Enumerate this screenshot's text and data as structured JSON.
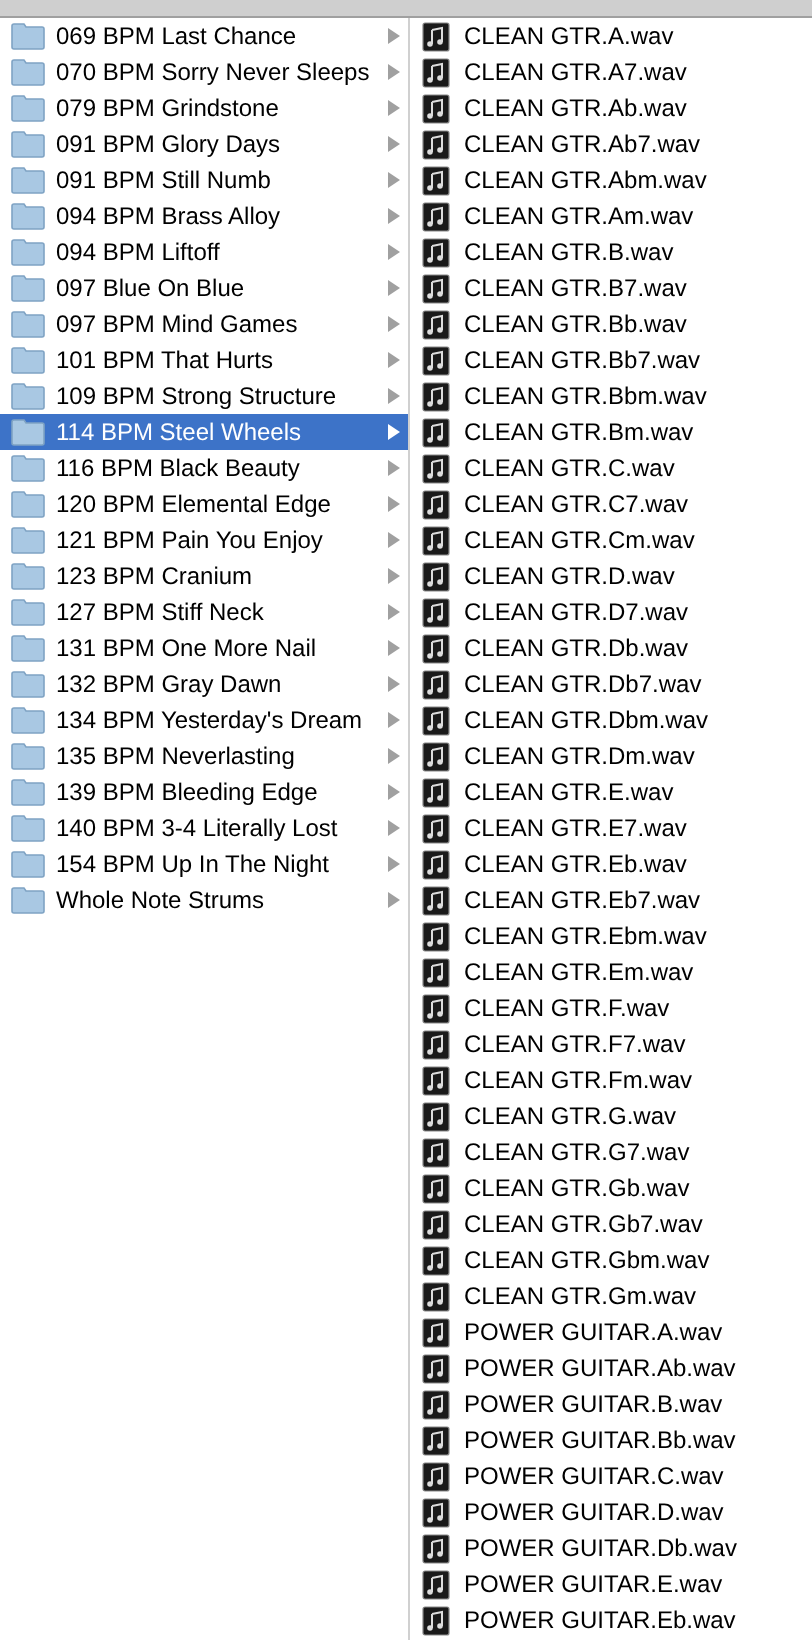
{
  "folders": [
    {
      "name": "069 BPM Last Chance",
      "selected": false
    },
    {
      "name": "070 BPM Sorry Never Sleeps",
      "selected": false
    },
    {
      "name": "079 BPM Grindstone",
      "selected": false
    },
    {
      "name": "091 BPM Glory Days",
      "selected": false
    },
    {
      "name": "091 BPM Still Numb",
      "selected": false
    },
    {
      "name": "094 BPM Brass Alloy",
      "selected": false
    },
    {
      "name": "094 BPM Liftoff",
      "selected": false
    },
    {
      "name": "097 Blue On Blue",
      "selected": false
    },
    {
      "name": "097 BPM Mind Games",
      "selected": false
    },
    {
      "name": "101 BPM That Hurts",
      "selected": false
    },
    {
      "name": "109 BPM Strong Structure",
      "selected": false
    },
    {
      "name": "114 BPM Steel Wheels",
      "selected": true
    },
    {
      "name": "116 BPM Black Beauty",
      "selected": false
    },
    {
      "name": "120 BPM Elemental Edge",
      "selected": false
    },
    {
      "name": "121 BPM Pain You Enjoy",
      "selected": false
    },
    {
      "name": "123 BPM Cranium",
      "selected": false
    },
    {
      "name": "127 BPM Stiff Neck",
      "selected": false
    },
    {
      "name": "131 BPM One More Nail",
      "selected": false
    },
    {
      "name": "132 BPM Gray Dawn",
      "selected": false
    },
    {
      "name": "134 BPM Yesterday's Dream",
      "selected": false
    },
    {
      "name": "135 BPM Neverlasting",
      "selected": false
    },
    {
      "name": "139 BPM Bleeding Edge",
      "selected": false
    },
    {
      "name": "140 BPM 3-4 Literally Lost",
      "selected": false
    },
    {
      "name": "154 BPM Up In The Night",
      "selected": false
    },
    {
      "name": "Whole Note Strums",
      "selected": false
    }
  ],
  "files": [
    "CLEAN GTR.A.wav",
    "CLEAN GTR.A7.wav",
    "CLEAN GTR.Ab.wav",
    "CLEAN GTR.Ab7.wav",
    "CLEAN GTR.Abm.wav",
    "CLEAN GTR.Am.wav",
    "CLEAN GTR.B.wav",
    "CLEAN GTR.B7.wav",
    "CLEAN GTR.Bb.wav",
    "CLEAN GTR.Bb7.wav",
    "CLEAN GTR.Bbm.wav",
    "CLEAN GTR.Bm.wav",
    "CLEAN GTR.C.wav",
    "CLEAN GTR.C7.wav",
    "CLEAN GTR.Cm.wav",
    "CLEAN GTR.D.wav",
    "CLEAN GTR.D7.wav",
    "CLEAN GTR.Db.wav",
    "CLEAN GTR.Db7.wav",
    "CLEAN GTR.Dbm.wav",
    "CLEAN GTR.Dm.wav",
    "CLEAN GTR.E.wav",
    "CLEAN GTR.E7.wav",
    "CLEAN GTR.Eb.wav",
    "CLEAN GTR.Eb7.wav",
    "CLEAN GTR.Ebm.wav",
    "CLEAN GTR.Em.wav",
    "CLEAN GTR.F.wav",
    "CLEAN GTR.F7.wav",
    "CLEAN GTR.Fm.wav",
    "CLEAN GTR.G.wav",
    "CLEAN GTR.G7.wav",
    "CLEAN GTR.Gb.wav",
    "CLEAN GTR.Gb7.wav",
    "CLEAN GTR.Gbm.wav",
    "CLEAN GTR.Gm.wav",
    "POWER GUITAR.A.wav",
    "POWER GUITAR.Ab.wav",
    "POWER GUITAR.B.wav",
    "POWER GUITAR.Bb.wav",
    "POWER GUITAR.C.wav",
    "POWER GUITAR.D.wav",
    "POWER GUITAR.Db.wav",
    "POWER GUITAR.E.wav",
    "POWER GUITAR.Eb.wav"
  ]
}
